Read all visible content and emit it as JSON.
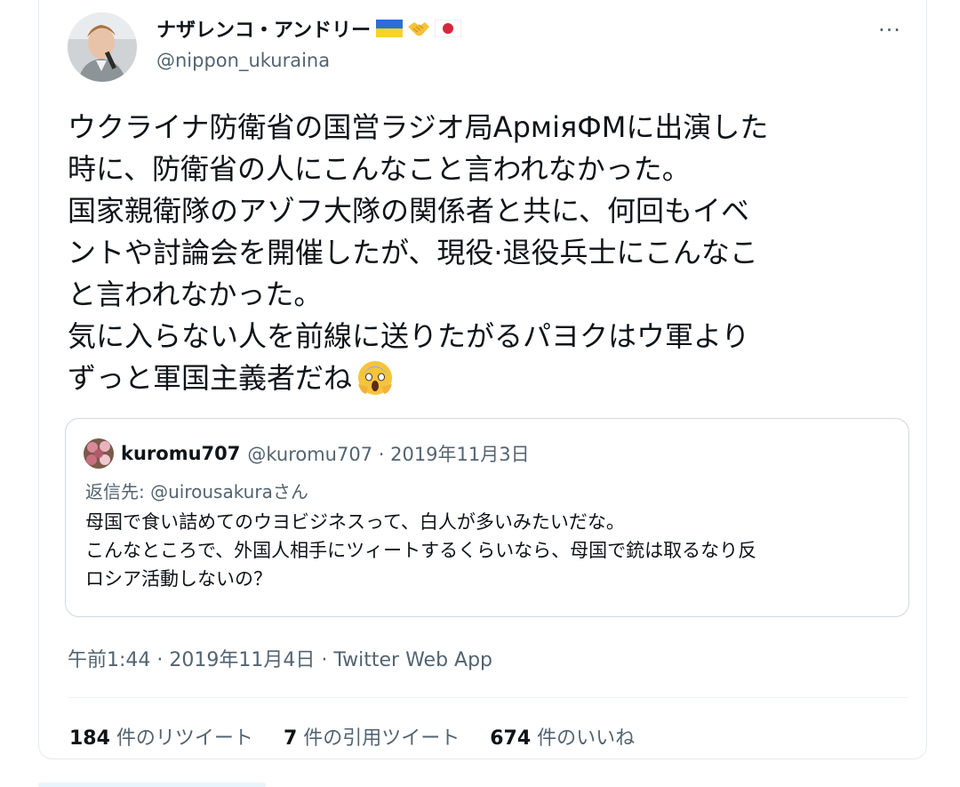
{
  "tweet": {
    "author_name": "ナザレンコ・アンドリー",
    "author_flags": [
      "ukraine-flag-icon",
      "handshake-icon",
      "japan-flag-icon"
    ],
    "author_handle": "@nippon_ukuraina",
    "more_label": "···",
    "text_lines": [
      "ウクライナ防衛省の国営ラジオ局АрміяФМに出演した",
      "時に、防衛省の人にこんなこと言われなかった。",
      "国家親衛隊のアゾフ大隊の関係者と共に、何回もイベ",
      "ントや討論会を開催したが、現役·退役兵士にこんなこ",
      "と言われなかった。",
      "気に入らない人を前線に送りたがるパヨクはウ軍より",
      "ずっと軍国主義者だね"
    ],
    "emoji": "screaming-face-icon",
    "timestamp": "午前1:44 · 2019年11月4日 · Twitter Web App"
  },
  "quote": {
    "name": "kuromu707",
    "meta": "@kuromu707 · 2019年11月3日",
    "reply_prefix": "返信先: ",
    "reply_handle": "@uirousakura",
    "reply_suffix": "さん",
    "text_lines": [
      "母国で食い詰めてのウヨビジネスって、白人が多いみたいだな。",
      "こんなところで、外国人相手にツィートするくらいなら、母国で銃は取るなり反",
      "ロシア活動しないの？"
    ]
  },
  "stats": {
    "retweets_count": "184",
    "retweets_label": " 件のリツイート",
    "quotes_count": "7",
    "quotes_label": " 件の引用ツイート",
    "likes_count": "674",
    "likes_label": " 件のいいね"
  },
  "colors": {
    "text_primary": "#0f1419",
    "text_secondary": "#536471",
    "border": "#cfd9de"
  }
}
